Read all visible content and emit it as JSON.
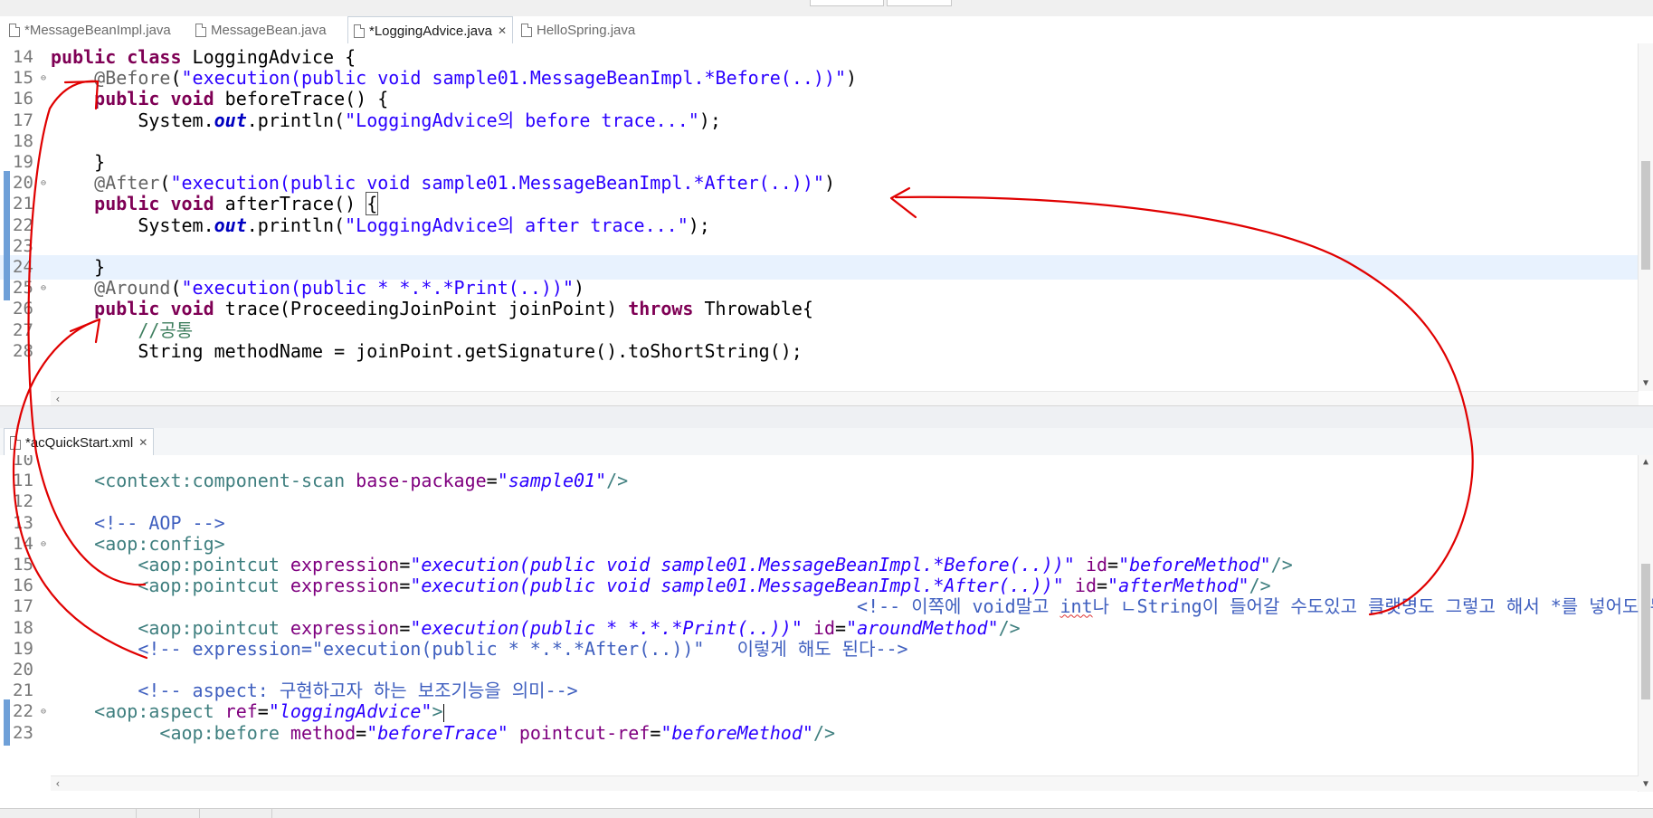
{
  "editor_top": {
    "tabs": [
      {
        "label": "*MessageBeanImpl.java",
        "active": false
      },
      {
        "label": "MessageBean.java",
        "active": false
      },
      {
        "label": "*LoggingAdvice.java",
        "active": true
      },
      {
        "label": "HelloSpring.java",
        "active": false
      }
    ],
    "lines": [
      {
        "n": "14",
        "tokens": [
          [
            "kw",
            "public"
          ],
          [
            "",
            "&nbsp;"
          ],
          [
            "kw",
            "class"
          ],
          [
            "",
            "&nbsp;LoggingAdvice&nbsp;{"
          ]
        ]
      },
      {
        "n": "15",
        "tokens": [
          [
            "",
            "&nbsp;&nbsp;&nbsp;&nbsp;"
          ],
          [
            "ann",
            "@Before"
          ],
          [
            "",
            "("
          ],
          [
            "str",
            "\"execution(public void sample01.MessageBeanImpl.*Before(..))\""
          ],
          [
            "",
            ")"
          ]
        ]
      },
      {
        "n": "16",
        "tokens": [
          [
            "",
            "&nbsp;&nbsp;&nbsp;&nbsp;"
          ],
          [
            "kw",
            "public"
          ],
          [
            "",
            "&nbsp;"
          ],
          [
            "kw",
            "void"
          ],
          [
            "",
            "&nbsp;beforeTrace()&nbsp;{"
          ]
        ]
      },
      {
        "n": "17",
        "tokens": [
          [
            "",
            "&nbsp;&nbsp;&nbsp;&nbsp;&nbsp;&nbsp;&nbsp;&nbsp;System."
          ],
          [
            "fld",
            "out"
          ],
          [
            "",
            ".println("
          ],
          [
            "str",
            "\"LoggingAdvice의 before trace...\""
          ],
          [
            "",
            ");"
          ]
        ]
      },
      {
        "n": "18",
        "tokens": []
      },
      {
        "n": "19",
        "tokens": [
          [
            "",
            "&nbsp;&nbsp;&nbsp;&nbsp;}"
          ]
        ]
      },
      {
        "n": "20",
        "tokens": [
          [
            "",
            "&nbsp;&nbsp;&nbsp;&nbsp;"
          ],
          [
            "ann",
            "@After"
          ],
          [
            "",
            "("
          ],
          [
            "str",
            "\"execution(public void sample01.MessageBeanImpl.*After(..))\""
          ],
          [
            "",
            ")"
          ]
        ]
      },
      {
        "n": "21",
        "tokens": [
          [
            "",
            "&nbsp;&nbsp;&nbsp;&nbsp;"
          ],
          [
            "kw",
            "public"
          ],
          [
            "",
            "&nbsp;"
          ],
          [
            "kw",
            "void"
          ],
          [
            "",
            "&nbsp;afterTrace()&nbsp;"
          ],
          [
            "box",
            "{"
          ]
        ]
      },
      {
        "n": "22",
        "tokens": [
          [
            "",
            "&nbsp;&nbsp;&nbsp;&nbsp;&nbsp;&nbsp;&nbsp;&nbsp;System."
          ],
          [
            "fld",
            "out"
          ],
          [
            "",
            ".println("
          ],
          [
            "str",
            "\"LoggingAdvice의 after trace...\""
          ],
          [
            "",
            ");"
          ]
        ]
      },
      {
        "n": "23",
        "tokens": []
      },
      {
        "n": "24",
        "tokens": [
          [
            "",
            "&nbsp;&nbsp;&nbsp;&nbsp;}"
          ]
        ]
      },
      {
        "n": "25",
        "tokens": [
          [
            "",
            "&nbsp;&nbsp;&nbsp;&nbsp;"
          ],
          [
            "ann",
            "@Around"
          ],
          [
            "",
            "("
          ],
          [
            "str",
            "\"execution(public * *.*.*Print(..))\""
          ],
          [
            "",
            ")"
          ]
        ]
      },
      {
        "n": "26",
        "tokens": [
          [
            "",
            "&nbsp;&nbsp;&nbsp;&nbsp;"
          ],
          [
            "kw",
            "public"
          ],
          [
            "",
            "&nbsp;"
          ],
          [
            "kw",
            "void"
          ],
          [
            "",
            "&nbsp;trace(ProceedingJoinPoint&nbsp;joinPoint)&nbsp;"
          ],
          [
            "kw",
            "throws"
          ],
          [
            "",
            "&nbsp;Throwable{"
          ]
        ]
      },
      {
        "n": "27",
        "tokens": [
          [
            "",
            "&nbsp;&nbsp;&nbsp;&nbsp;&nbsp;&nbsp;&nbsp;&nbsp;"
          ],
          [
            "cmt",
            "//공통"
          ]
        ]
      },
      {
        "n": "28",
        "tokens": [
          [
            "",
            "&nbsp;&nbsp;&nbsp;&nbsp;&nbsp;&nbsp;&nbsp;&nbsp;String&nbsp;methodName&nbsp;=&nbsp;joinPoint.getSignature().toShortString();"
          ]
        ]
      }
    ]
  },
  "editor_bottom": {
    "tab": {
      "label": "*acQuickStart.xml"
    },
    "lines": [
      {
        "n": "10",
        "tokens": []
      },
      {
        "n": "11",
        "tokens": [
          [
            "",
            "&nbsp;&nbsp;&nbsp;&nbsp;"
          ],
          [
            "tag",
            "&lt;context:component-scan"
          ],
          [
            "",
            "&nbsp;"
          ],
          [
            "attr",
            "base-package"
          ],
          [
            "",
            "="
          ],
          [
            "aval",
            "\"sample01\""
          ],
          [
            "tag",
            "/&gt;"
          ]
        ]
      },
      {
        "n": "12",
        "tokens": []
      },
      {
        "n": "13",
        "tokens": [
          [
            "",
            "&nbsp;&nbsp;&nbsp;&nbsp;"
          ],
          [
            "xcmt",
            "&lt;!-- AOP --&gt;"
          ]
        ]
      },
      {
        "n": "14",
        "tokens": [
          [
            "",
            "&nbsp;&nbsp;&nbsp;&nbsp;"
          ],
          [
            "tag",
            "&lt;aop:config&gt;"
          ]
        ]
      },
      {
        "n": "15",
        "tokens": [
          [
            "",
            "&nbsp;&nbsp;&nbsp;&nbsp;&nbsp;&nbsp;&nbsp;&nbsp;"
          ],
          [
            "tag",
            "&lt;aop:pointcut"
          ],
          [
            "",
            "&nbsp;"
          ],
          [
            "attr",
            "expression"
          ],
          [
            "",
            "="
          ],
          [
            "aval",
            "\"execution(public void sample01.MessageBeanImpl.*Before(..))\""
          ],
          [
            "",
            "&nbsp;"
          ],
          [
            "attr",
            "id"
          ],
          [
            "",
            "="
          ],
          [
            "aval",
            "\"beforeMethod\""
          ],
          [
            "tag",
            "/&gt;"
          ]
        ]
      },
      {
        "n": "16",
        "tokens": [
          [
            "",
            "&nbsp;&nbsp;&nbsp;&nbsp;&nbsp;&nbsp;&nbsp;&nbsp;"
          ],
          [
            "tag",
            "&lt;aop:pointcut"
          ],
          [
            "",
            "&nbsp;"
          ],
          [
            "attr",
            "expression"
          ],
          [
            "",
            "="
          ],
          [
            "aval",
            "\"execution(public void sample01.MessageBeanImpl.*After(..))\""
          ],
          [
            "",
            "&nbsp;"
          ],
          [
            "attr",
            "id"
          ],
          [
            "",
            "="
          ],
          [
            "aval",
            "\"afterMethod\""
          ],
          [
            "tag",
            "/&gt;"
          ]
        ]
      },
      {
        "n": "17",
        "tokens": [
          [
            "",
            "&nbsp;&nbsp;&nbsp;&nbsp;&nbsp;&nbsp;&nbsp;&nbsp;&nbsp;&nbsp;&nbsp;&nbsp;&nbsp;&nbsp;&nbsp;&nbsp;&nbsp;&nbsp;&nbsp;&nbsp;&nbsp;&nbsp;&nbsp;&nbsp;&nbsp;&nbsp;&nbsp;&nbsp;&nbsp;&nbsp;&nbsp;&nbsp;&nbsp;&nbsp;&nbsp;&nbsp;&nbsp;&nbsp;&nbsp;&nbsp;&nbsp;&nbsp;&nbsp;&nbsp;&nbsp;&nbsp;&nbsp;&nbsp;&nbsp;&nbsp;&nbsp;&nbsp;&nbsp;&nbsp;&nbsp;&nbsp;&nbsp;&nbsp;&nbsp;&nbsp;&nbsp;&nbsp;&nbsp;&nbsp;&nbsp;&nbsp;&nbsp;&nbsp;&nbsp;&nbsp;&nbsp;&nbsp;&nbsp;&nbsp;"
          ],
          [
            "xcmt",
            "&lt;!-- 이쪽에 void말고 "
          ],
          [
            "xsq",
            "int"
          ],
          [
            "xcmt",
            "나 ㄴString이 들어갈 수도있고 클랫명도 그렇고 해서 *를 넣어도 된다. --&gt;"
          ]
        ]
      },
      {
        "n": "18",
        "tokens": [
          [
            "",
            "&nbsp;&nbsp;&nbsp;&nbsp;&nbsp;&nbsp;&nbsp;&nbsp;"
          ],
          [
            "tag",
            "&lt;aop:pointcut"
          ],
          [
            "",
            "&nbsp;"
          ],
          [
            "attr",
            "expression"
          ],
          [
            "",
            "="
          ],
          [
            "aval",
            "\"execution(public * *.*.*Print(..))\""
          ],
          [
            "",
            "&nbsp;"
          ],
          [
            "attr",
            "id"
          ],
          [
            "",
            "="
          ],
          [
            "aval",
            "\"aroundMethod\""
          ],
          [
            "tag",
            "/&gt;"
          ]
        ]
      },
      {
        "n": "19",
        "tokens": [
          [
            "",
            "&nbsp;&nbsp;&nbsp;&nbsp;&nbsp;&nbsp;&nbsp;&nbsp;"
          ],
          [
            "xcmt",
            "&lt;!-- expression=\"execution(public * *.*.*After(..))\"&nbsp;&nbsp;&nbsp;이렇게 해도 된다--&gt;"
          ]
        ]
      },
      {
        "n": "20",
        "tokens": []
      },
      {
        "n": "21",
        "tokens": [
          [
            "",
            "&nbsp;&nbsp;&nbsp;&nbsp;&nbsp;&nbsp;&nbsp;&nbsp;"
          ],
          [
            "xcmt",
            "&lt;!-- aspect: 구현하고자 하는 보조기능을 의미--&gt;"
          ]
        ]
      },
      {
        "n": "22",
        "tokens": [
          [
            "",
            "&nbsp;&nbsp;&nbsp;&nbsp;"
          ],
          [
            "tag",
            "&lt;aop:aspect"
          ],
          [
            "",
            "&nbsp;"
          ],
          [
            "attr",
            "ref"
          ],
          [
            "",
            "="
          ],
          [
            "aval",
            "\"loggingAdvice\""
          ],
          [
            "tag",
            "&gt;"
          ],
          [
            "caret",
            ""
          ]
        ]
      },
      {
        "n": "23",
        "tokens": [
          [
            "",
            "&nbsp;&nbsp;&nbsp;&nbsp;&nbsp;&nbsp;&nbsp;&nbsp;&nbsp;&nbsp;"
          ],
          [
            "tag",
            "&lt;aop:before"
          ],
          [
            "",
            "&nbsp;"
          ],
          [
            "attr",
            "method"
          ],
          [
            "",
            "="
          ],
          [
            "aval",
            "\"beforeTrace\""
          ],
          [
            "",
            "&nbsp;"
          ],
          [
            "attr",
            "pointcut-ref"
          ],
          [
            "",
            "="
          ],
          [
            "aval",
            "\"beforeMethod\""
          ],
          [
            "tag",
            "/&gt;"
          ]
        ]
      }
    ]
  },
  "colors": {
    "annotation_ink": "#e00000",
    "line_highlight": "#e8f2fe",
    "change_marker": "#6fa0d8"
  }
}
